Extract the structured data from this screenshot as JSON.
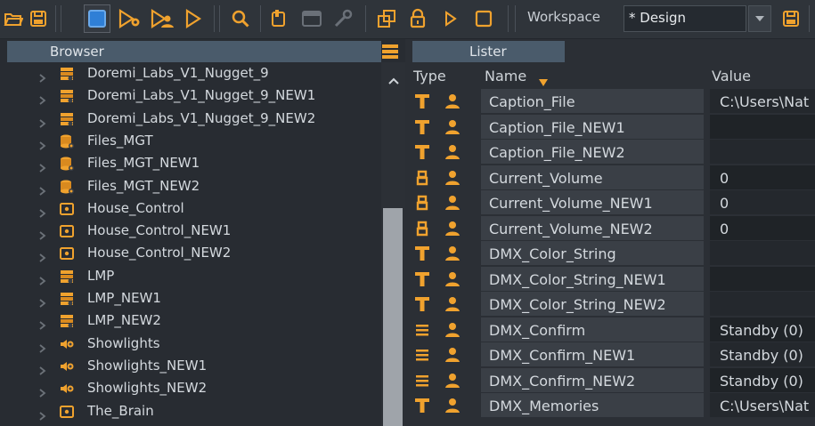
{
  "toolbar": {
    "workspace_label": "Workspace",
    "workspace_value": "* Design",
    "icons": [
      "folder-open-icon",
      "save-icon",
      "select-icon",
      "run-settings-icon",
      "run-user-icon",
      "play-outline-icon",
      "search-icon",
      "new-item-icon",
      "window-icon",
      "wrench-icon",
      "copy-icon",
      "lock-icon",
      "play-small-icon",
      "stop-icon",
      "dropdown-icon",
      "save-workspace-icon"
    ]
  },
  "browser": {
    "title": "Browser",
    "items": [
      {
        "label": "Doremi_Labs_V1_Nugget_9",
        "icon": "device-icon"
      },
      {
        "label": "Doremi_Labs_V1_Nugget_9_NEW1",
        "icon": "device-icon"
      },
      {
        "label": "Doremi_Labs_V1_Nugget_9_NEW2",
        "icon": "device-icon"
      },
      {
        "label": "Files_MGT",
        "icon": "database-icon"
      },
      {
        "label": "Files_MGT_NEW1",
        "icon": "database-icon"
      },
      {
        "label": "Files_MGT_NEW2",
        "icon": "database-icon"
      },
      {
        "label": "House_Control",
        "icon": "control-box-icon"
      },
      {
        "label": "House_Control_NEW1",
        "icon": "control-box-icon"
      },
      {
        "label": "House_Control_NEW2",
        "icon": "control-box-icon"
      },
      {
        "label": "LMP",
        "icon": "device-icon"
      },
      {
        "label": "LMP_NEW1",
        "icon": "device-icon"
      },
      {
        "label": "LMP_NEW2",
        "icon": "device-icon"
      },
      {
        "label": "Showlights",
        "icon": "speaker-icon"
      },
      {
        "label": "Showlights_NEW1",
        "icon": "speaker-icon"
      },
      {
        "label": "Showlights_NEW2",
        "icon": "speaker-icon"
      },
      {
        "label": "The_Brain",
        "icon": "control-box-icon"
      }
    ]
  },
  "lister": {
    "title": "Lister",
    "columns": {
      "type": "Type",
      "name": "Name",
      "value": "Value"
    },
    "rows": [
      {
        "type": "text",
        "name": "Caption_File",
        "value": "C:\\Users\\Nat"
      },
      {
        "type": "text",
        "name": "Caption_File_NEW1",
        "value": ""
      },
      {
        "type": "text",
        "name": "Caption_File_NEW2",
        "value": ""
      },
      {
        "type": "number",
        "name": "Current_Volume",
        "value": "0"
      },
      {
        "type": "number",
        "name": "Current_Volume_NEW1",
        "value": "0"
      },
      {
        "type": "number",
        "name": "Current_Volume_NEW2",
        "value": "0"
      },
      {
        "type": "text",
        "name": "DMX_Color_String",
        "value": ""
      },
      {
        "type": "text",
        "name": "DMX_Color_String_NEW1",
        "value": ""
      },
      {
        "type": "text",
        "name": "DMX_Color_String_NEW2",
        "value": ""
      },
      {
        "type": "enum",
        "name": "DMX_Confirm",
        "value": "Standby (0)"
      },
      {
        "type": "enum",
        "name": "DMX_Confirm_NEW1",
        "value": "Standby (0)"
      },
      {
        "type": "enum",
        "name": "DMX_Confirm_NEW2",
        "value": "Standby (0)"
      },
      {
        "type": "text",
        "name": "DMX_Memories",
        "value": "C:\\Users\\Nat"
      }
    ]
  },
  "colors": {
    "accent": "#f0a22e",
    "panel_header": "#4a5b6b",
    "selected_blue": "#2f7fd6"
  }
}
